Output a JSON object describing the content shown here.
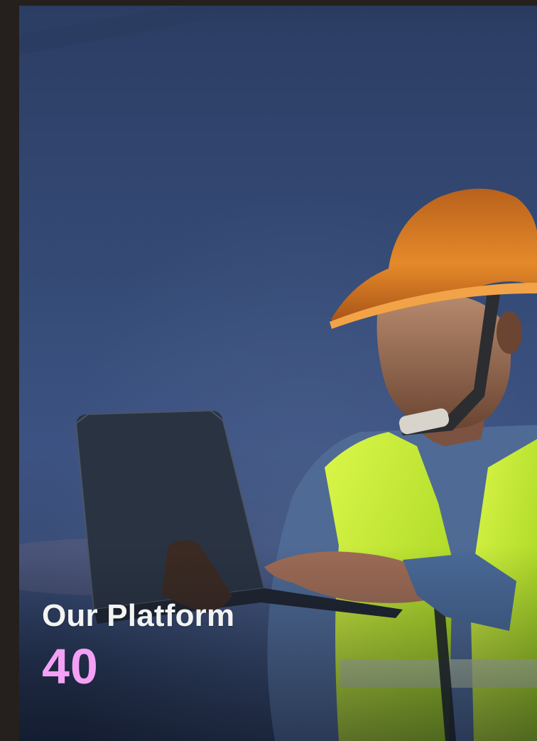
{
  "card": {
    "title": "Our Platform",
    "number": "40"
  },
  "image": {
    "subject": "worker-with-laptop",
    "description_icon": "photo-image"
  },
  "colors": {
    "page_background": "#25201d",
    "title_text": "#f3f3f3",
    "number_text": "#f3a0f5",
    "sky": "#3c5282",
    "helmet": "#d8771e",
    "vest": "#c7ef2a"
  }
}
